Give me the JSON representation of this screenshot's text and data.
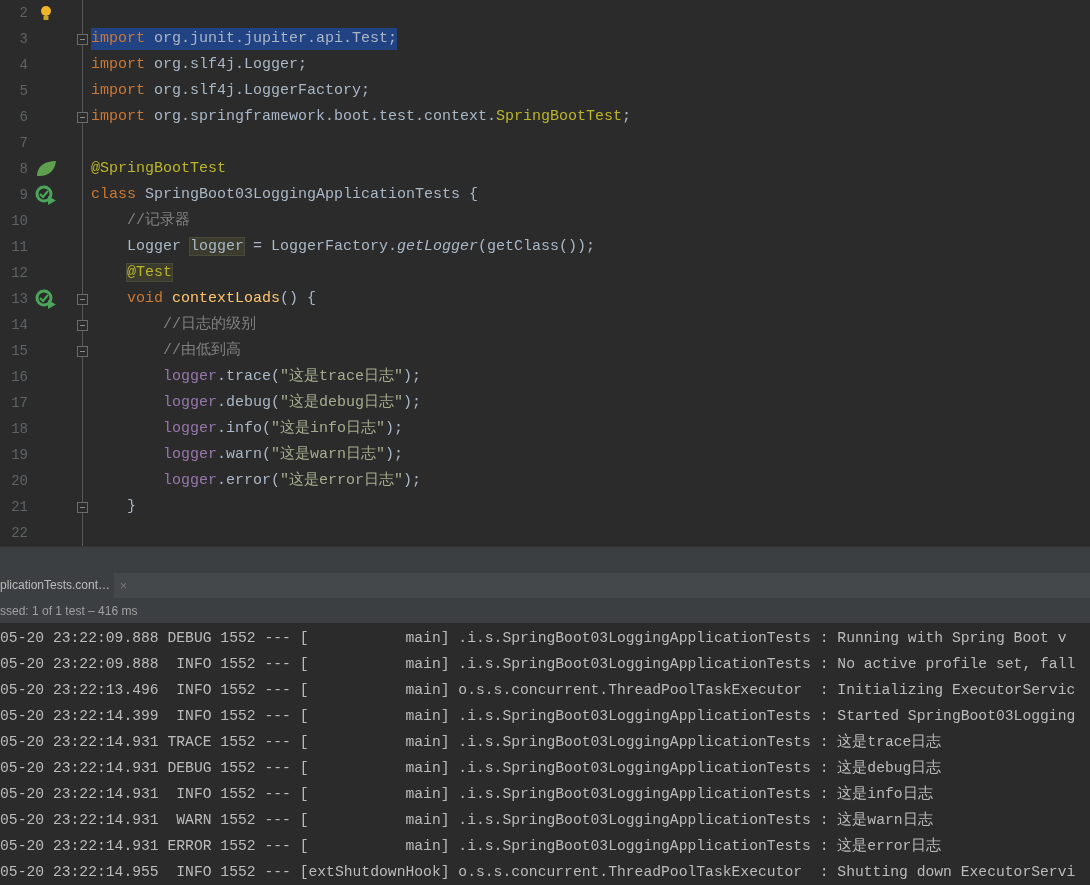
{
  "editor": {
    "lines": [
      {
        "number": "2",
        "kind": "top",
        "gutter_icon": {
          "kind": "bulb"
        },
        "fold": false,
        "selected": false
      },
      {
        "number": "3",
        "kind": "top",
        "fold": true,
        "selected": true,
        "tokens": [
          {
            "text": "import",
            "kind": "keyword"
          },
          {
            "text": " org.junit.jupiter.api.Test;",
            "kind": "plain"
          }
        ]
      },
      {
        "number": "4",
        "kind": "top",
        "fold": false,
        "selected": false,
        "tokens": [
          {
            "text": "import",
            "kind": "keyword"
          },
          {
            "text": " org.slf4j.Logger;",
            "kind": "plain"
          }
        ]
      },
      {
        "number": "5",
        "kind": "top",
        "fold": false,
        "selected": false,
        "tokens": [
          {
            "text": "import",
            "kind": "keyword"
          },
          {
            "text": " org.slf4j.LoggerFactory;",
            "kind": "plain"
          }
        ]
      },
      {
        "number": "6",
        "kind": "top",
        "fold": true,
        "selected": false,
        "tokens": [
          {
            "text": "import",
            "kind": "keyword"
          },
          {
            "text": " org.springframework.boot.test.context.",
            "kind": "plain"
          },
          {
            "text": "SpringBootTest",
            "kind": "annotation"
          },
          {
            "text": ";",
            "kind": "plain"
          }
        ]
      },
      {
        "number": "7",
        "kind": "top",
        "fold": false,
        "selected": false
      },
      {
        "number": "8",
        "kind": "top",
        "gutter_icon": {
          "kind": "leaf"
        },
        "fold": false,
        "selected": false,
        "tokens": [
          {
            "text": "@SpringBootTest",
            "kind": "annotation"
          }
        ]
      },
      {
        "number": "9",
        "kind": "top",
        "gutter_icon": {
          "kind": "run"
        },
        "fold": false,
        "selected": false,
        "tokens": [
          {
            "text": "class",
            "kind": "keyword"
          },
          {
            "text": " SpringBoot03LoggingApplicationTests {",
            "kind": "plain"
          }
        ]
      },
      {
        "number": "10",
        "kind": "member",
        "fold": false,
        "selected": false,
        "tokens": [
          {
            "text": "//记录器",
            "kind": "comment"
          }
        ]
      },
      {
        "number": "11",
        "kind": "member",
        "fold": false,
        "selected": false,
        "tokens": [
          {
            "text": "Logger ",
            "kind": "plain"
          },
          {
            "text": "logger",
            "kind": "usage"
          },
          {
            "text": " = LoggerFactory.",
            "kind": "plain"
          },
          {
            "text": "getLogger",
            "kind": "static"
          },
          {
            "text": "(getClass());",
            "kind": "plain"
          }
        ]
      },
      {
        "number": "12",
        "kind": "member",
        "fold": false,
        "selected": false,
        "tokens": [
          {
            "text": "@Test",
            "kind": "annotation-usage"
          }
        ]
      },
      {
        "number": "13",
        "kind": "member",
        "gutter_icon": {
          "kind": "run"
        },
        "fold": true,
        "selected": false,
        "tokens": [
          {
            "text": "void",
            "kind": "keyword"
          },
          {
            "text": " contextLoads",
            "kind": "method"
          },
          {
            "text": "() {",
            "kind": "plain"
          }
        ]
      },
      {
        "number": "14",
        "kind": "body",
        "fold": true,
        "selected": false,
        "tokens": [
          {
            "text": "//日志的级别",
            "kind": "comment"
          }
        ]
      },
      {
        "number": "15",
        "kind": "body",
        "fold": true,
        "selected": false,
        "tokens": [
          {
            "text": "//由低到高",
            "kind": "comment"
          }
        ]
      },
      {
        "number": "16",
        "kind": "body",
        "fold": false,
        "selected": false,
        "tokens": [
          {
            "text": "logger",
            "kind": "field"
          },
          {
            "text": ".trace(",
            "kind": "plain"
          },
          {
            "text": "\"这是trace日志\"",
            "kind": "string"
          },
          {
            "text": ");",
            "kind": "plain"
          }
        ]
      },
      {
        "number": "17",
        "kind": "body",
        "fold": false,
        "selected": false,
        "tokens": [
          {
            "text": "logger",
            "kind": "field"
          },
          {
            "text": ".debug(",
            "kind": "plain"
          },
          {
            "text": "\"这是debug日志\"",
            "kind": "string"
          },
          {
            "text": ");",
            "kind": "plain"
          }
        ]
      },
      {
        "number": "18",
        "kind": "body",
        "fold": false,
        "selected": false,
        "tokens": [
          {
            "text": "logger",
            "kind": "field"
          },
          {
            "text": ".info(",
            "kind": "plain"
          },
          {
            "text": "\"这是info日志\"",
            "kind": "string"
          },
          {
            "text": ");",
            "kind": "plain"
          }
        ]
      },
      {
        "number": "19",
        "kind": "body",
        "fold": false,
        "selected": false,
        "tokens": [
          {
            "text": "logger",
            "kind": "field"
          },
          {
            "text": ".warn(",
            "kind": "plain"
          },
          {
            "text": "\"这是warn日志\"",
            "kind": "string"
          },
          {
            "text": ");",
            "kind": "plain"
          }
        ]
      },
      {
        "number": "20",
        "kind": "body",
        "fold": false,
        "selected": false,
        "tokens": [
          {
            "text": "logger",
            "kind": "field"
          },
          {
            "text": ".error(",
            "kind": "plain"
          },
          {
            "text": "\"这是error日志\"",
            "kind": "string"
          },
          {
            "text": ");",
            "kind": "plain"
          }
        ]
      },
      {
        "number": "21",
        "kind": "member",
        "fold": true,
        "selected": false,
        "tokens": [
          {
            "text": "}",
            "kind": "plain"
          }
        ]
      },
      {
        "number": "22",
        "kind": "top",
        "fold": false,
        "selected": false
      }
    ]
  },
  "run_panel": {
    "tab": {
      "label": "plicationTests.cont…",
      "close": "×"
    },
    "status": "ssed: 1 of 1 test – 416 ms",
    "log_lines": [
      "05-20 23:22:09.888 DEBUG 1552 --- [           main] .i.s.SpringBoot03LoggingApplicationTests : Running with Spring Boot v",
      "05-20 23:22:09.888  INFO 1552 --- [           main] .i.s.SpringBoot03LoggingApplicationTests : No active profile set, fall",
      "05-20 23:22:13.496  INFO 1552 --- [           main] o.s.s.concurrent.ThreadPoolTaskExecutor  : Initializing ExecutorServic",
      "05-20 23:22:14.399  INFO 1552 --- [           main] .i.s.SpringBoot03LoggingApplicationTests : Started SpringBoot03Logging",
      "05-20 23:22:14.931 TRACE 1552 --- [           main] .i.s.SpringBoot03LoggingApplicationTests : 这是trace日志",
      "05-20 23:22:14.931 DEBUG 1552 --- [           main] .i.s.SpringBoot03LoggingApplicationTests : 这是debug日志",
      "05-20 23:22:14.931  INFO 1552 --- [           main] .i.s.SpringBoot03LoggingApplicationTests : 这是info日志",
      "05-20 23:22:14.931  WARN 1552 --- [           main] .i.s.SpringBoot03LoggingApplicationTests : 这是warn日志",
      "05-20 23:22:14.931 ERROR 1552 --- [           main] .i.s.SpringBoot03LoggingApplicationTests : 这是error日志",
      "05-20 23:22:14.955  INFO 1552 --- [extShutdownHook] o.s.s.concurrent.ThreadPoolTaskExecutor  : Shutting down ExecutorServi"
    ]
  }
}
